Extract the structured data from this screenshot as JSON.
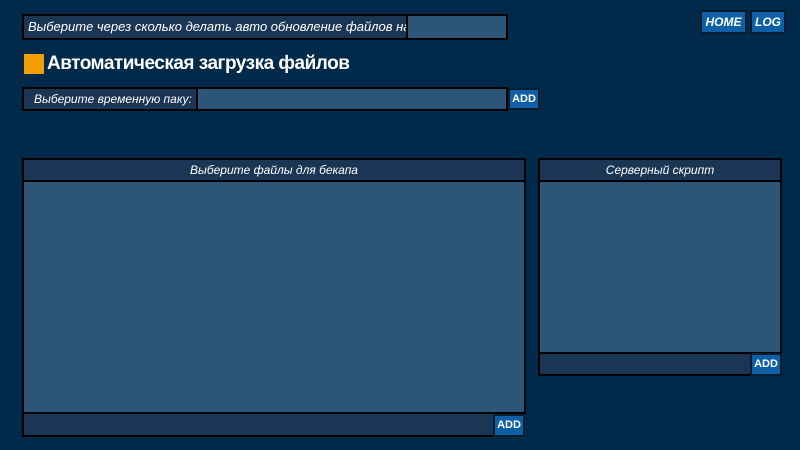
{
  "interval": {
    "label": "Выберите через сколько делать авто обновление файлов на сервер:",
    "value": ""
  },
  "nav": {
    "home_label": "HOME",
    "log_label": "LOG"
  },
  "heading": {
    "title": "Автоматическая загрузка файлов",
    "accent_color": "#f29e05"
  },
  "temp_folder": {
    "label": "Выберите временную паку:",
    "value": "",
    "add_label": "ADD"
  },
  "files_panel": {
    "title": "Выберите файлы для бекапа",
    "add_label": "ADD"
  },
  "script_panel": {
    "title": "Серверный скрипт",
    "add_label": "ADD"
  },
  "colors": {
    "background": "#012a4a",
    "panel_fill": "#2d5577",
    "header_fill": "#1b3654",
    "button_fill": "#0d5fa6"
  }
}
